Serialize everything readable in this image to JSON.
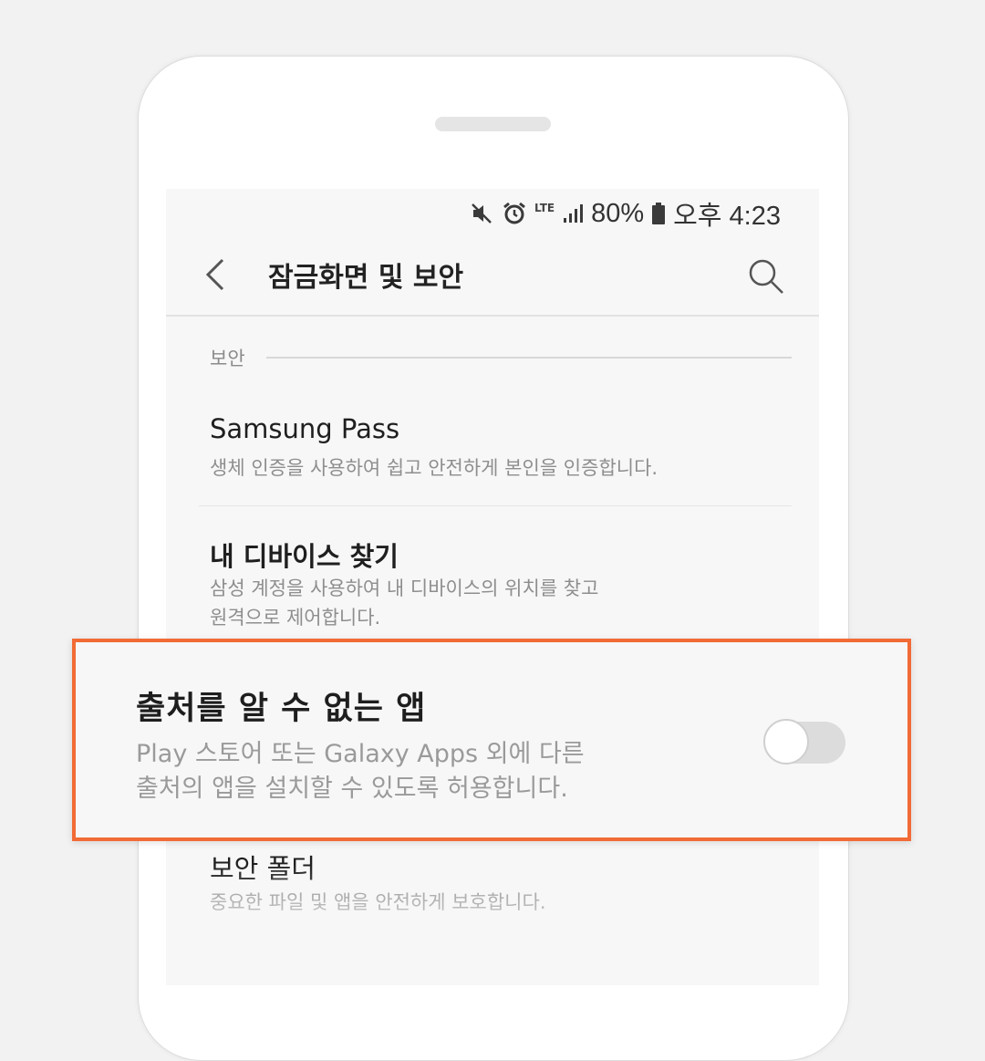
{
  "statusbar": {
    "battery": "80%",
    "time": "오후 4:23",
    "network": "LTE"
  },
  "appbar": {
    "title": "잠금화면 및 보안"
  },
  "section": {
    "header": "보안"
  },
  "items": [
    {
      "title": "Samsung Pass",
      "subtitle": [
        "생체 인증을 사용하여 쉽고 안전하게 본인을 인증합니다."
      ]
    },
    {
      "title": "내 디바이스 찾기",
      "subtitle": [
        "삼성 계정을 사용하여 내 디바이스의 위치를 찾고",
        "원격으로 제어합니다."
      ]
    },
    {
      "title": "보안 폴더",
      "subtitle": [
        "중요한 파일 및 앱을 안전하게 보호합니다."
      ]
    }
  ],
  "highlight": {
    "title": "출처를 알 수 없는 앱",
    "subtitle": [
      "Play 스토어 또는 Galaxy Apps 외에 다른",
      "출처의 앱을 설치할 수 있도록 허용합니다."
    ],
    "toggle_on": false,
    "border_color": "#f26b36"
  },
  "icons": [
    "mute-icon",
    "alarm-icon",
    "signal-icon",
    "battery-icon",
    "back-arrow-icon",
    "search-icon"
  ]
}
